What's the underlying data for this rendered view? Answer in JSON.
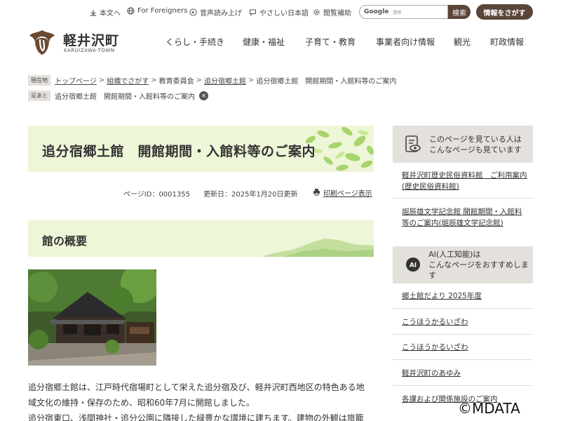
{
  "utility": {
    "text_version": "本文へ",
    "foreigners": "For Foreigners",
    "voice": "音声読み上げ",
    "easy_japanese": "やさしい日本語",
    "assist": "閲覧補助",
    "search_brand": "Google",
    "search_small": "提供",
    "search_button": "検索",
    "info_button": "情報をさがす"
  },
  "header": {
    "town_name": "軽井沢町",
    "town_sub": "KARUIZAWA-TOWN",
    "nav": [
      "くらし・手続き",
      "健康・福祉",
      "子育て・教育",
      "事業者向け情報",
      "観光",
      "町政情報"
    ]
  },
  "breadcrumb": {
    "label": "現在地",
    "items": [
      "トップページ",
      "組織でさがす",
      "教育委員会",
      "追分宿郷土館",
      "追分宿郷土館　開館期間・入館料等のご案内"
    ]
  },
  "footprint": {
    "label": "足あと",
    "item": "追分宿郷土館　開館期間・入館料等のご案内",
    "close": "×"
  },
  "page": {
    "title": "追分宿郷土館　開館期間・入館料等のご案内",
    "page_id": "ページID：0001355",
    "updated": "更新日：2025年1月20日更新",
    "print": "印刷ページ表示",
    "section_title": "館の概要",
    "body_lines": [
      "追分宿郷土館は、江戸時代宿場町として栄えた追分宿及び、軽井沢町西地区の特色ある地",
      "域文化の維持・保存のため、昭和60年7月に開館しました。",
      "追分宿東口、浅間神社・追分公園に隣接した緑豊かな環境に建ちます。建物の外観は旅籠"
    ]
  },
  "sidebar": {
    "related_head": [
      "このページを見ている人は",
      "こんなページも見ています"
    ],
    "related_links": [
      "軽井沢町歴史民俗資料館　ご利用案内(歴史民俗資料館)",
      "堀辰雄文学記念館 開館期間・入館料等のご案内(堀辰雄文学記念館)"
    ],
    "ai_head": [
      "AI(人工知能)は",
      "こんなページをおすすめします"
    ],
    "ai_icon": "AI",
    "ai_links": [
      "郷土館だより 2025年度",
      "こうほうかるいざわ",
      "こうほうかるいざわ",
      "軽井沢町のあゆみ",
      "各課および関係施設のご案内"
    ]
  },
  "watermark": "©MDATA",
  "colors": {
    "brand_brown": "#5a4538",
    "title_band": "#eef6d8",
    "side_head": "#e4e0dc"
  }
}
